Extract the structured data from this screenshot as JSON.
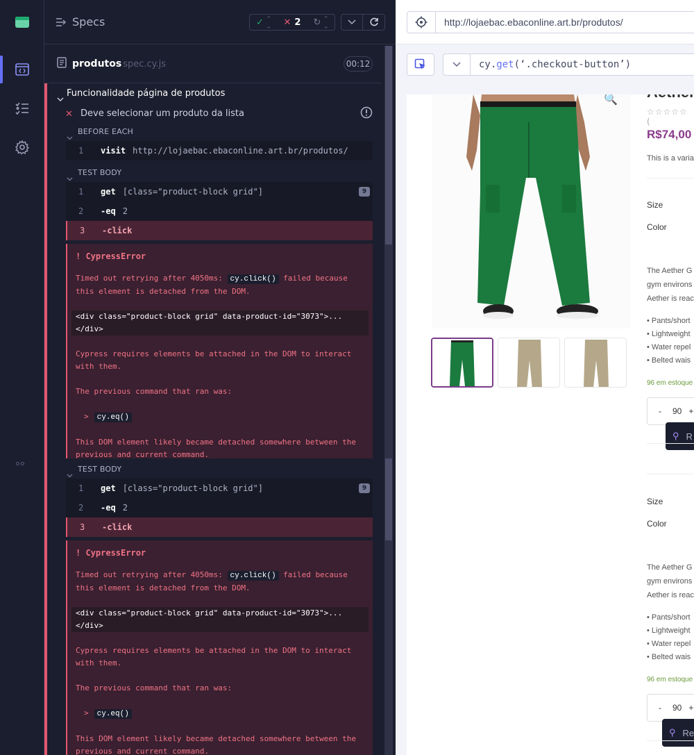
{
  "reporter": {
    "specs_title": "Specs",
    "stats": {
      "passed": "--",
      "failed": "2",
      "pending": "--"
    },
    "spec": {
      "name": "produtos",
      "ext": "spec.cy.js",
      "time": "00:12"
    },
    "suite_title": "Funcionalidade página de produtos",
    "test_title": "Deve selecionar um produto da lista",
    "before_each": {
      "title": "BEFORE EACH",
      "commands": [
        {
          "num": "1",
          "name": "visit",
          "message": "http://lojaebac.ebaconline.art.br/produtos/"
        }
      ]
    },
    "attempts": [
      {
        "title": "TEST BODY",
        "commands": [
          {
            "num": "1",
            "name": "get",
            "message": "[class=\"product-block grid\"]",
            "badge": "9"
          },
          {
            "num": "2",
            "name": "-eq",
            "message": "2"
          },
          {
            "num": "3",
            "name": "-click",
            "message": ""
          }
        ],
        "error": {
          "title": "CypressError",
          "line1_a": "Timed out retrying after 4050ms: ",
          "line1_code": "cy.click()",
          "line1_b": " failed because this element is detached from the DOM.",
          "element": "<div class=\"product-block grid\" data-product-id=\"3073\">...</div>",
          "line2": "Cypress requires elements be attached in the DOM to interact with them.",
          "line3": "The previous command that ran was:",
          "prev_cmd": "cy.eq()",
          "line4": "This DOM element likely became detached somewhere between the previous and current command."
        }
      },
      {
        "title": "TEST BODY",
        "commands": [
          {
            "num": "1",
            "name": "get",
            "message": "[class=\"product-block grid\"]",
            "badge": "9"
          },
          {
            "num": "2",
            "name": "-eq",
            "message": "2"
          },
          {
            "num": "3",
            "name": "-click",
            "message": ""
          }
        ],
        "error": {
          "title": "CypressError",
          "line1_a": "Timed out retrying after 4050ms: ",
          "line1_code": "cy.click()",
          "line1_b": " failed because this element is detached from the DOM.",
          "element": "<div class=\"product-block grid\" data-product-id=\"3073\">...</div>",
          "line2": "Cypress requires elements be attached in the DOM to interact with them.",
          "line3": "The previous command that ran was:",
          "prev_cmd": "cy.eq()",
          "line4": "This DOM element likely became detached somewhere between the previous and current command."
        }
      }
    ]
  },
  "browser": {
    "url": "http://lojaebac.ebaconline.art.br/produtos/",
    "selector_prefix": "cy.",
    "selector_fn": "get",
    "selector_arg": "(‘.checkout-button’)"
  },
  "product": {
    "title": "Aether",
    "price": "R$74,00",
    "short_desc": "This is a varia",
    "size_label": "Size",
    "color_label": "Color",
    "desc_lines": [
      "The Aether G",
      "gym environs",
      "Aether is reac"
    ],
    "bullets": [
      "• Pants/short",
      "• Lightweight",
      "• Water repel",
      "• Belted wais"
    ],
    "stock": "96 em estoque",
    "qty": "90",
    "qty_minus": "-",
    "qty_plus": "+",
    "tip_label": "R",
    "tip_label2": "Re"
  },
  "colors": {
    "fail": "#e45770",
    "pass": "#1fa971",
    "accent": "#6470f3",
    "price": "#8a3b8a"
  }
}
